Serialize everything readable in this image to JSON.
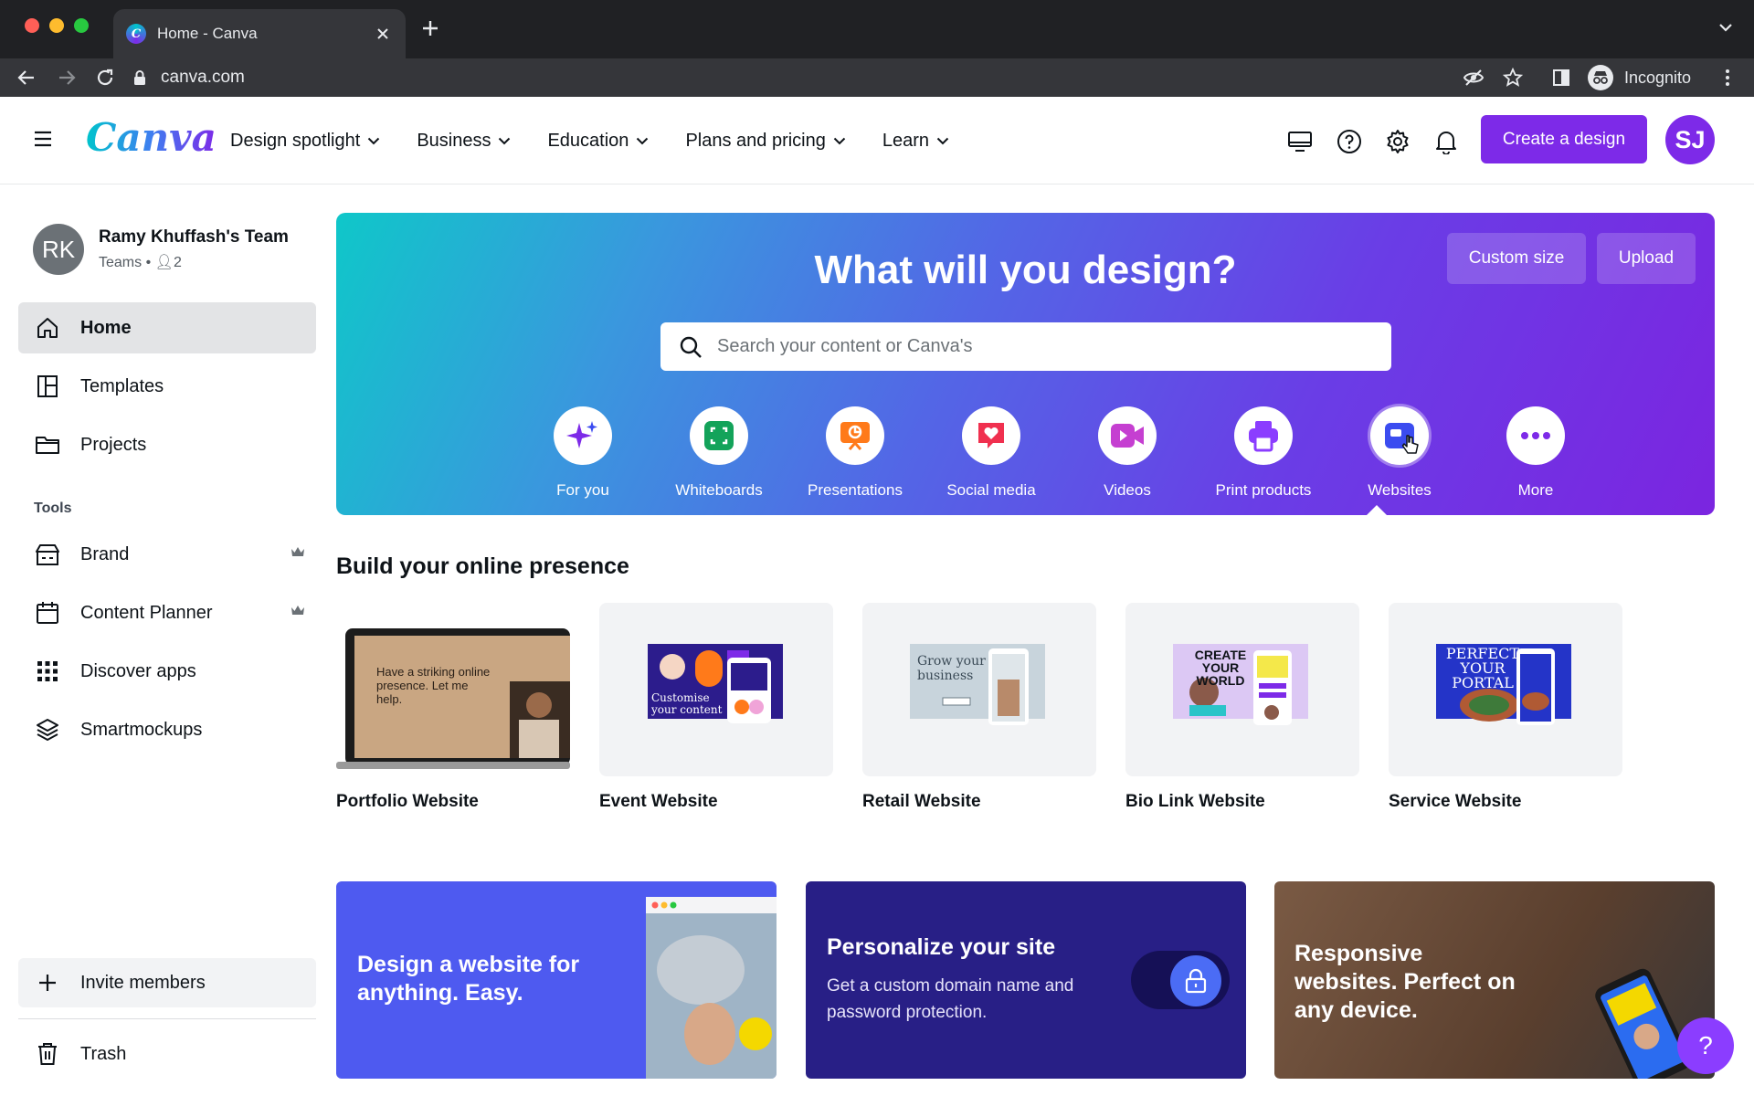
{
  "browser": {
    "tab_title": "Home - Canva",
    "url": "canva.com",
    "profile_label": "Incognito"
  },
  "header": {
    "logo": "Canva",
    "nav": [
      {
        "label": "Design spotlight"
      },
      {
        "label": "Business"
      },
      {
        "label": "Education"
      },
      {
        "label": "Plans and pricing"
      },
      {
        "label": "Learn"
      }
    ],
    "create_label": "Create a design",
    "avatar_initials": "SJ"
  },
  "sidebar": {
    "team_initials": "RK",
    "team_name": "Ramy Khuffash's Team",
    "team_type": "Teams",
    "team_members": "2",
    "items": [
      {
        "label": "Home",
        "icon": "home-icon"
      },
      {
        "label": "Templates",
        "icon": "templates-icon"
      },
      {
        "label": "Projects",
        "icon": "folder-icon"
      }
    ],
    "tools_label": "Tools",
    "tools": [
      {
        "label": "Brand",
        "icon": "brand-icon",
        "crown": true
      },
      {
        "label": "Content Planner",
        "icon": "calendar-icon",
        "crown": true
      },
      {
        "label": "Discover apps",
        "icon": "apps-grid-icon",
        "crown": false
      },
      {
        "label": "Smartmockups",
        "icon": "layers-icon",
        "crown": false
      }
    ],
    "invite_label": "Invite members",
    "trash_label": "Trash"
  },
  "hero": {
    "title": "What will you design?",
    "custom_size_label": "Custom size",
    "upload_label": "Upload",
    "search_placeholder": "Search your content or Canva's",
    "categories": [
      {
        "label": "For you",
        "icon": "sparkle-icon",
        "color": "#7d2ae8"
      },
      {
        "label": "Whiteboards",
        "icon": "whiteboard-icon",
        "color": "#13a35a"
      },
      {
        "label": "Presentations",
        "icon": "presentation-icon",
        "color": "#ff7a1a"
      },
      {
        "label": "Social media",
        "icon": "heart-icon",
        "color": "#f0304f"
      },
      {
        "label": "Videos",
        "icon": "video-icon",
        "color": "#c53fd1"
      },
      {
        "label": "Print products",
        "icon": "printer-icon",
        "color": "#8b3dff"
      },
      {
        "label": "Websites",
        "icon": "website-icon",
        "color": "#3b4cf0",
        "active": true
      },
      {
        "label": "More",
        "icon": "more-icon",
        "color": "#7d2ae8"
      }
    ]
  },
  "section": {
    "title": "Build your online presence",
    "cards": [
      {
        "label": "Portfolio Website",
        "thumb_text": "Have a striking online presence. Let me help."
      },
      {
        "label": "Event Website",
        "thumb_text": "Customise your content"
      },
      {
        "label": "Retail Website",
        "thumb_text": "Grow your business"
      },
      {
        "label": "Bio Link Website",
        "thumb_text": "CREATE YOUR WORLD"
      },
      {
        "label": "Service Website",
        "thumb_text": "PERFECT YOUR PORTAL"
      }
    ]
  },
  "promos": [
    {
      "title": "Design a website for anything. Easy.",
      "bg": "#4e5af0"
    },
    {
      "title": "Personalize your site",
      "subtitle": "Get a custom domain name and password protection.",
      "bg": "#281f86"
    },
    {
      "title": "Responsive websites. Perfect on any device.",
      "bg": "#6b4a36"
    }
  ],
  "help_label": "?"
}
